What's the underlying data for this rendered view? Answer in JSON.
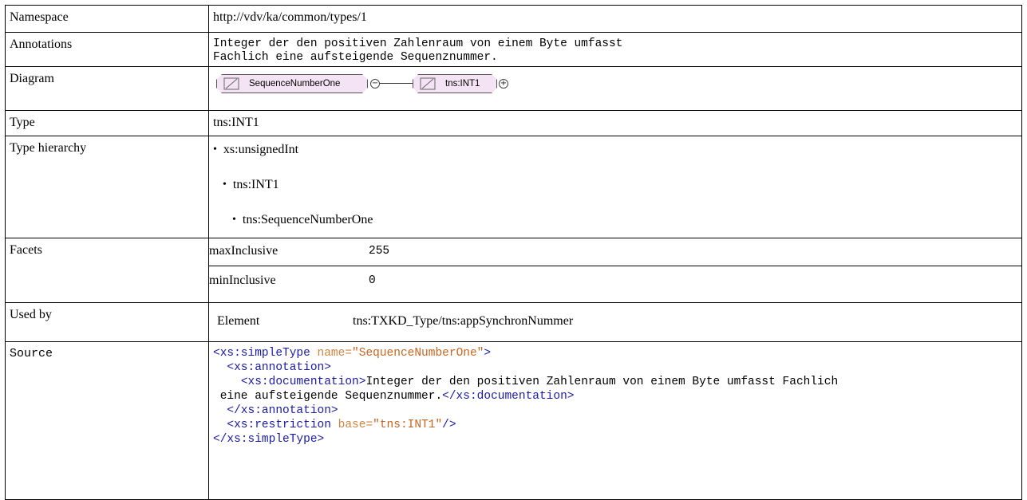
{
  "rows": {
    "namespace": {
      "label": "Namespace",
      "value": "http://vdv/ka/common/types/1"
    },
    "annotations": {
      "label": "Annotations",
      "lines": [
        "Integer der den positiven Zahlenraum von einem Byte umfasst",
        "Fachlich eine aufsteigende Sequenznummer."
      ]
    },
    "diagram": {
      "label": "Diagram",
      "node1": "SequenceNumberOne",
      "node2": "tns:INT1",
      "collapse_symbol": "−",
      "expand_symbol": "+"
    },
    "type": {
      "label": "Type",
      "value": "tns:INT1"
    },
    "hierarchy": {
      "label": "Type hierarchy",
      "items": [
        "xs:unsignedInt",
        "tns:INT1",
        "tns:SequenceNumberOne"
      ]
    },
    "facets": {
      "label": "Facets",
      "items": [
        {
          "name": "maxInclusive",
          "value": "255"
        },
        {
          "name": "minInclusive",
          "value": "0"
        }
      ]
    },
    "usedby": {
      "label": "Used by",
      "kind": "Element",
      "ref": "tns:TXKD_Type/tns:appSynchronNummer"
    },
    "source": {
      "label": "Source",
      "l1_tag": "<xs:simpleType",
      "l1_attr": "name=",
      "l1_val": "\"SequenceNumberOne\"",
      "l1_end": ">",
      "l2": "<xs:annotation>",
      "l3_open": "<xs:documentation>",
      "l3_text": "Integer der den positiven Zahlenraum von einem Byte umfasst Fachlich",
      "l4_text": "eine aufsteigende Sequenznummer.",
      "l4_close": "</xs:documentation>",
      "l5": "</xs:annotation>",
      "l6_tag": "<xs:restriction",
      "l6_attr": "base=",
      "l6_val": "\"tns:INT1\"",
      "l6_end": "/>",
      "l7": "</xs:simpleType>"
    }
  }
}
